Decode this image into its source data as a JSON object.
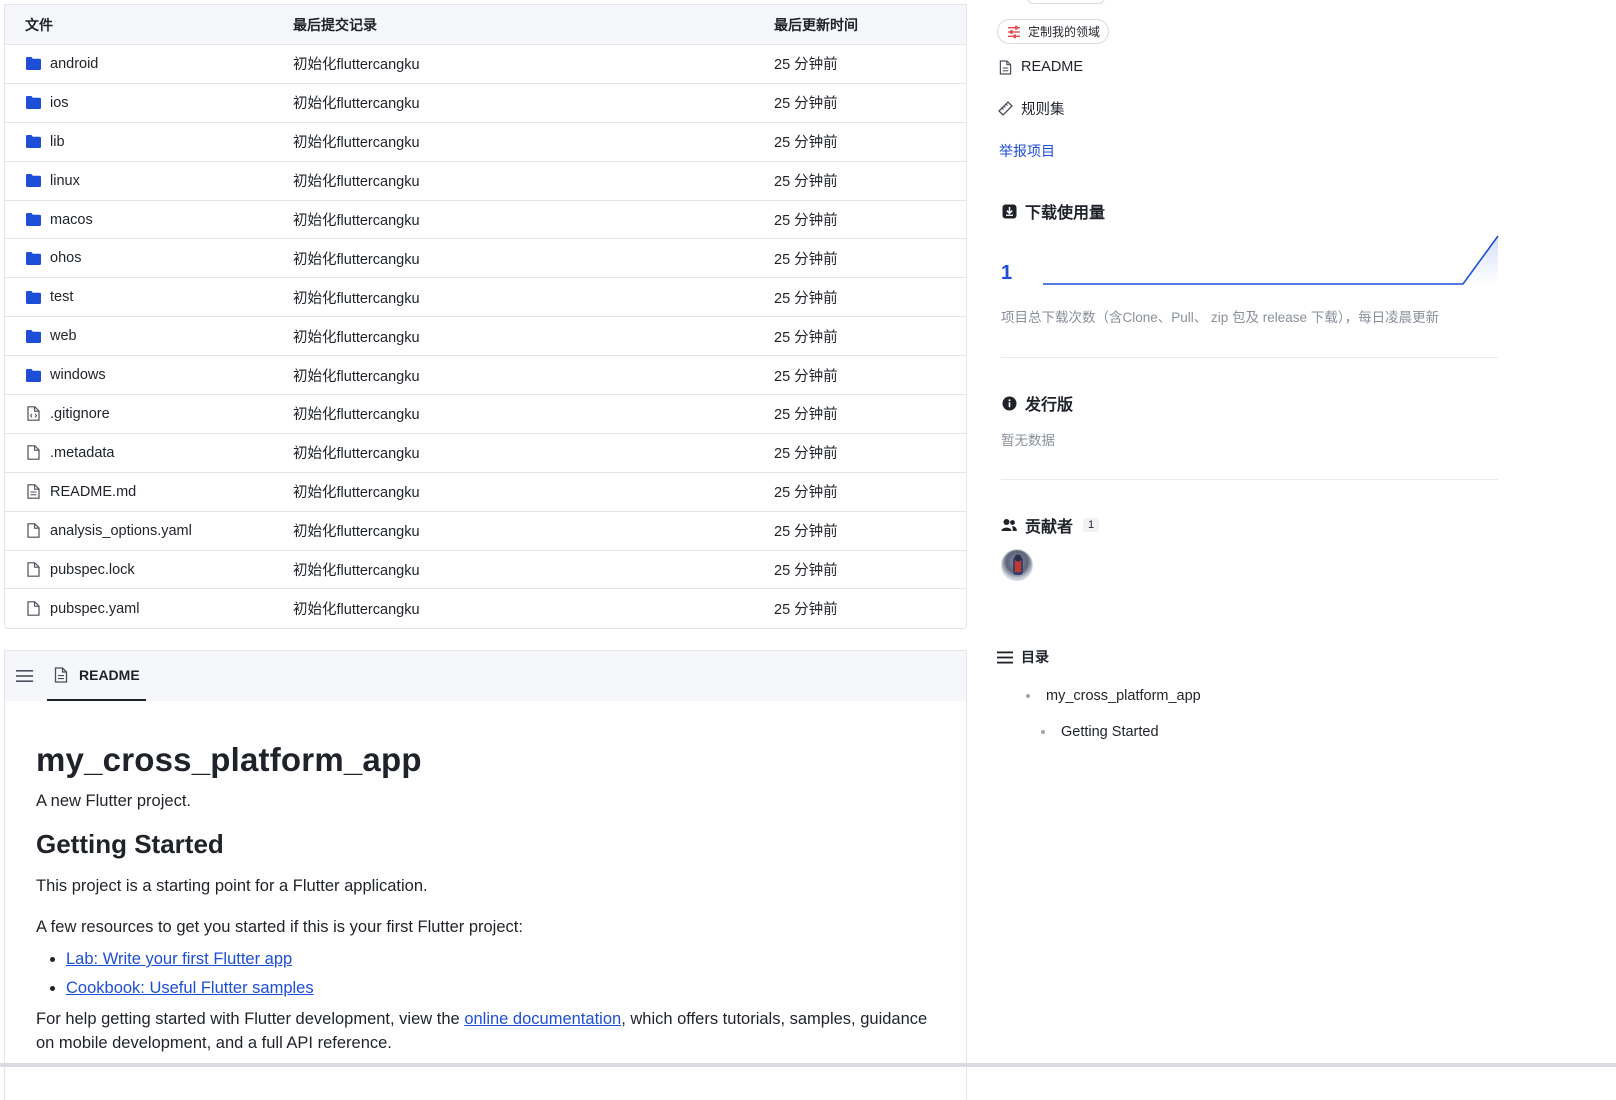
{
  "table": {
    "headers": {
      "name": "文件",
      "commit": "最后提交记录",
      "time": "最后更新时间"
    },
    "rows": [
      {
        "name": "android",
        "type": "folder",
        "commit": "初始化fluttercangku",
        "time": "25 分钟前"
      },
      {
        "name": "ios",
        "type": "folder",
        "commit": "初始化fluttercangku",
        "time": "25 分钟前"
      },
      {
        "name": "lib",
        "type": "folder",
        "commit": "初始化fluttercangku",
        "time": "25 分钟前"
      },
      {
        "name": "linux",
        "type": "folder",
        "commit": "初始化fluttercangku",
        "time": "25 分钟前"
      },
      {
        "name": "macos",
        "type": "folder",
        "commit": "初始化fluttercangku",
        "time": "25 分钟前"
      },
      {
        "name": "ohos",
        "type": "folder",
        "commit": "初始化fluttercangku",
        "time": "25 分钟前"
      },
      {
        "name": "test",
        "type": "folder",
        "commit": "初始化fluttercangku",
        "time": "25 分钟前"
      },
      {
        "name": "web",
        "type": "folder",
        "commit": "初始化fluttercangku",
        "time": "25 分钟前"
      },
      {
        "name": "windows",
        "type": "folder",
        "commit": "初始化fluttercangku",
        "time": "25 分钟前"
      },
      {
        "name": ".gitignore",
        "type": "code-file",
        "commit": "初始化fluttercangku",
        "time": "25 分钟前"
      },
      {
        "name": ".metadata",
        "type": "file",
        "commit": "初始化fluttercangku",
        "time": "25 分钟前"
      },
      {
        "name": "README.md",
        "type": "doc-file",
        "commit": "初始化fluttercangku",
        "time": "25 分钟前"
      },
      {
        "name": "analysis_options.yaml",
        "type": "file",
        "commit": "初始化fluttercangku",
        "time": "25 分钟前"
      },
      {
        "name": "pubspec.lock",
        "type": "file",
        "commit": "初始化fluttercangku",
        "time": "25 分钟前"
      },
      {
        "name": "pubspec.yaml",
        "type": "file",
        "commit": "初始化fluttercangku",
        "time": "25 分钟前"
      }
    ]
  },
  "readme": {
    "tab_label": "README",
    "h1": "my_cross_platform_app",
    "intro": "A new Flutter project.",
    "h2": "Getting Started",
    "p1": "This project is a starting point for a Flutter application.",
    "p2": "A few resources to get you started if this is your first Flutter project:",
    "links": [
      "Lab: Write your first Flutter app",
      "Cookbook: Useful Flutter samples"
    ],
    "help_before": "For help getting started with Flutter development, view the ",
    "help_link": "online documentation",
    "help_after": ", which offers tutorials, samples, guidance",
    "help_line2": "on mobile development, and a full API reference."
  },
  "sidebar": {
    "customize_label": "定制我的领域",
    "readme_link": "README",
    "rules_link": "规则集",
    "report_link": "举报项目",
    "downloads": {
      "title": "下载使用量",
      "count": "1",
      "description": "项目总下载次数（含Clone、Pull、 zip 包及 release 下载），每日凌晨更新"
    },
    "releases": {
      "title": "发行版",
      "empty": "暂无数据"
    },
    "contributors": {
      "title": "贡献者",
      "count": "1"
    },
    "toc": {
      "title": "目录",
      "items": [
        "my_cross_platform_app",
        "Getting Started"
      ]
    }
  },
  "colors": {
    "link": "#1d4ed8",
    "folder": "#1d4ed8",
    "muted": "#8a8f99",
    "accent_red": "#e5484d"
  }
}
